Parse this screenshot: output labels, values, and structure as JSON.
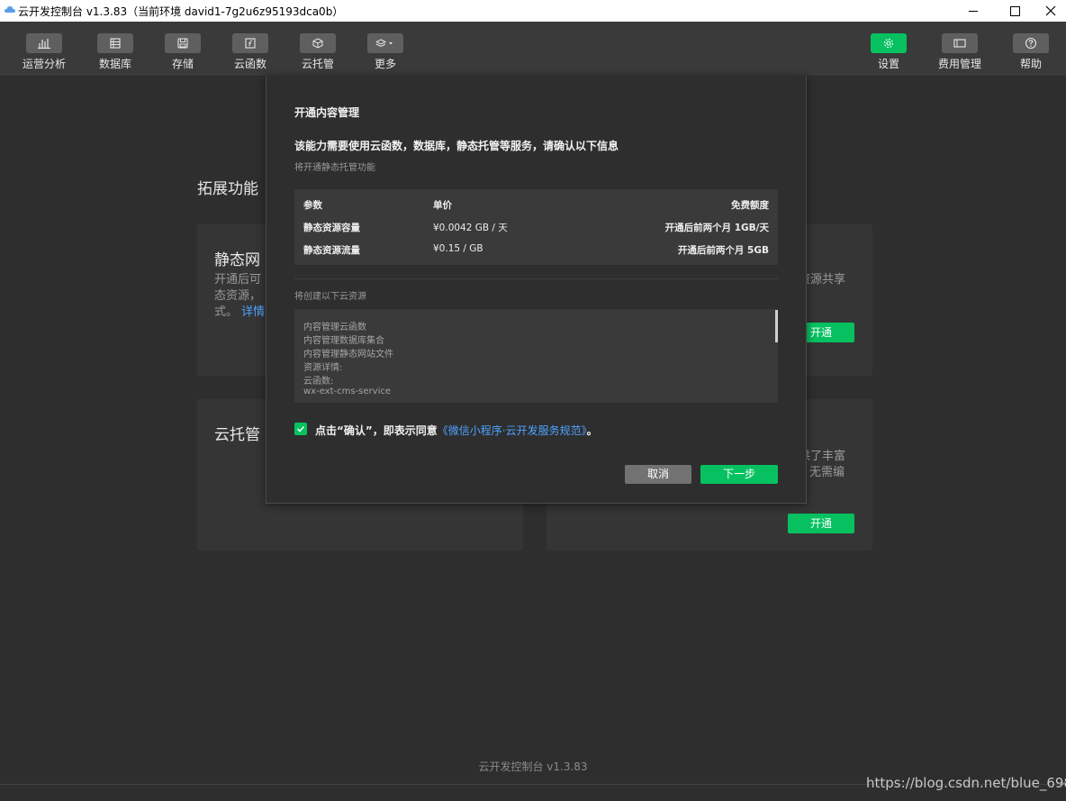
{
  "window": {
    "title": "云开发控制台 v1.3.83（当前环境 david1-7g2u6z95193dca0b）"
  },
  "toolbar": {
    "left": [
      {
        "label": "运营分析",
        "icon": "bar-chart-icon"
      },
      {
        "label": "数据库",
        "icon": "database-icon"
      },
      {
        "label": "存储",
        "icon": "storage-icon"
      },
      {
        "label": "云函数",
        "icon": "function-icon"
      },
      {
        "label": "云托管",
        "icon": "cube-icon"
      },
      {
        "label": "更多",
        "icon": "layers-icon"
      }
    ],
    "right": [
      {
        "label": "设置",
        "icon": "gear-icon"
      },
      {
        "label": "费用管理",
        "icon": "billing-icon"
      },
      {
        "label": "帮助",
        "icon": "help-icon"
      }
    ]
  },
  "page": {
    "section_title": "拓展功能",
    "card1": {
      "title": "静态网",
      "desc_line1": "开通后可",
      "desc_line2": "态资源，",
      "desc_line3": "式。",
      "link": "详情",
      "right_text": "资源共享"
    },
    "card1_button": "开通",
    "card2": {
      "title": "云托管",
      "right_text1": "供了丰富",
      "right_text2": "无需编"
    },
    "card2_button": "开通",
    "footer": "云开发控制台 v1.3.83",
    "watermark": "https://blog.csdn.net/blue_698"
  },
  "dialog": {
    "title": "开通内容管理",
    "heading": "该能力需要使用云函数，数据库，静态托管等服务，请确认以下信息",
    "subtitle": "将开通静态托管功能",
    "table": {
      "headers": [
        "参数",
        "单价",
        "免费额度"
      ],
      "rows": [
        [
          "静态资源容量",
          "¥0.0042 GB / 天",
          "开通后前两个月 1GB/天"
        ],
        [
          "静态资源流量",
          "¥0.15 / GB",
          "开通后前两个月 5GB"
        ]
      ]
    },
    "resources_label": "将创建以下云资源",
    "resources": [
      "内容管理云函数",
      "内容管理数据库集合",
      "内容管理静态网站文件",
      "资源详情:",
      "云函数:",
      "wx-ext-cms-service"
    ],
    "agree_prefix": "点击“确认”，即表示同意",
    "agree_link": "《微信小程序·云开发服务规范》",
    "agree_suffix": "。",
    "cancel_label": "取消",
    "next_label": "下一步"
  }
}
